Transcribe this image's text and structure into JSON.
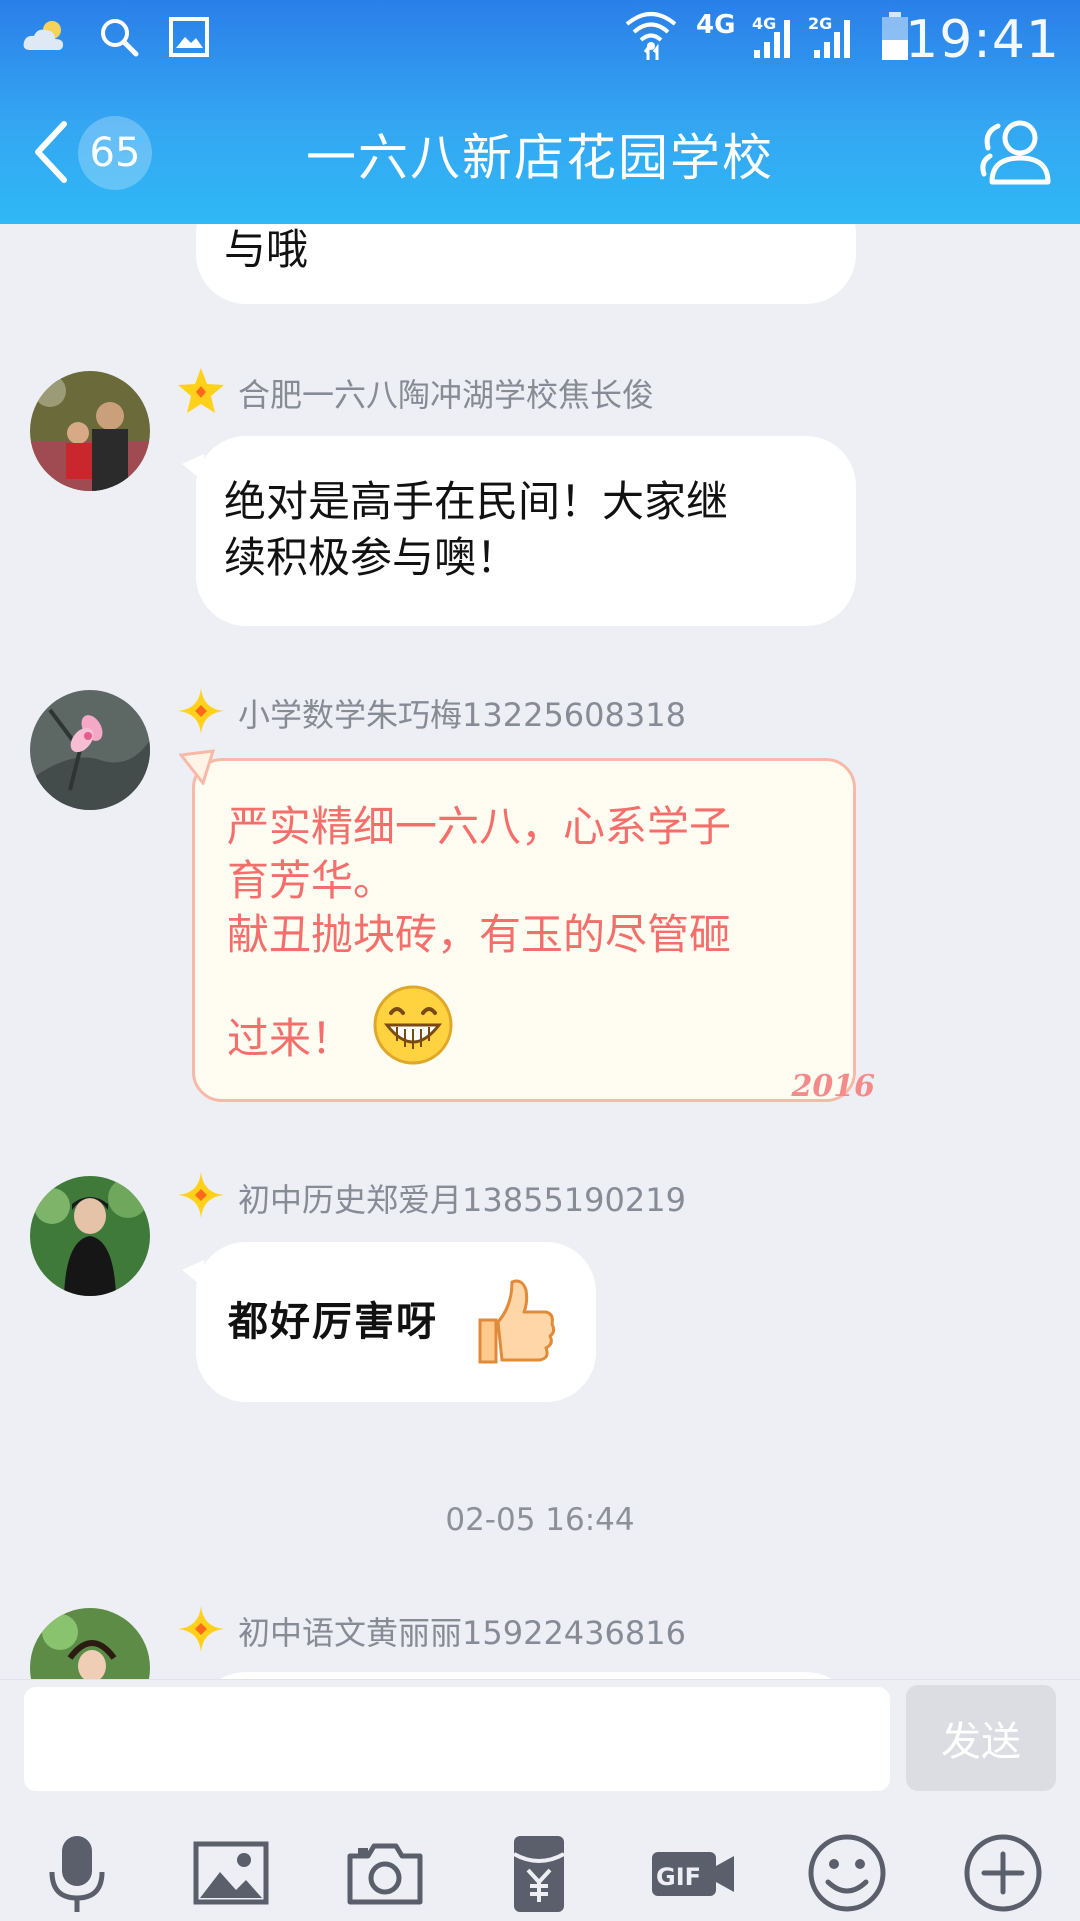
{
  "status_bar": {
    "time": "19:41",
    "network_primary": "4G",
    "network_sim1": "4G",
    "network_sim2": "2G"
  },
  "nav": {
    "unread_count": "65",
    "title": "一六八新店花园学校"
  },
  "messages": [
    {
      "partial_text": "与哦"
    },
    {
      "sender": "合肥一六八陶冲湖学校焦长俊",
      "line1": "绝对是高手在民间！大家继",
      "line2": "续积极参与噢！"
    },
    {
      "sender": "小学数学朱巧梅13225608318",
      "line1": "严实精细一六八，心系学子",
      "line2": "育芳华。",
      "line3": "献丑抛块砖，有玉的尽管砸",
      "line4": "过来！",
      "sticker_year": "2016"
    },
    {
      "sender": "初中历史郑爱月13855190219",
      "text": "都好厉害呀"
    }
  ],
  "timestamp": "02-05 16:44",
  "last_sender": "初中语文黄丽丽15922436816",
  "input": {
    "value": "",
    "send_label": "发送"
  },
  "colors": {
    "header_top": "#2a7fe8",
    "header_bottom": "#2fb8f5",
    "chat_bg": "#eeeff5",
    "special_text": "#f46f6b",
    "sender_text": "#878b95"
  },
  "toolbar_icons": [
    "microphone-icon",
    "image-icon",
    "camera-icon",
    "red-packet-icon",
    "gif-icon",
    "emoji-icon",
    "plus-icon"
  ]
}
